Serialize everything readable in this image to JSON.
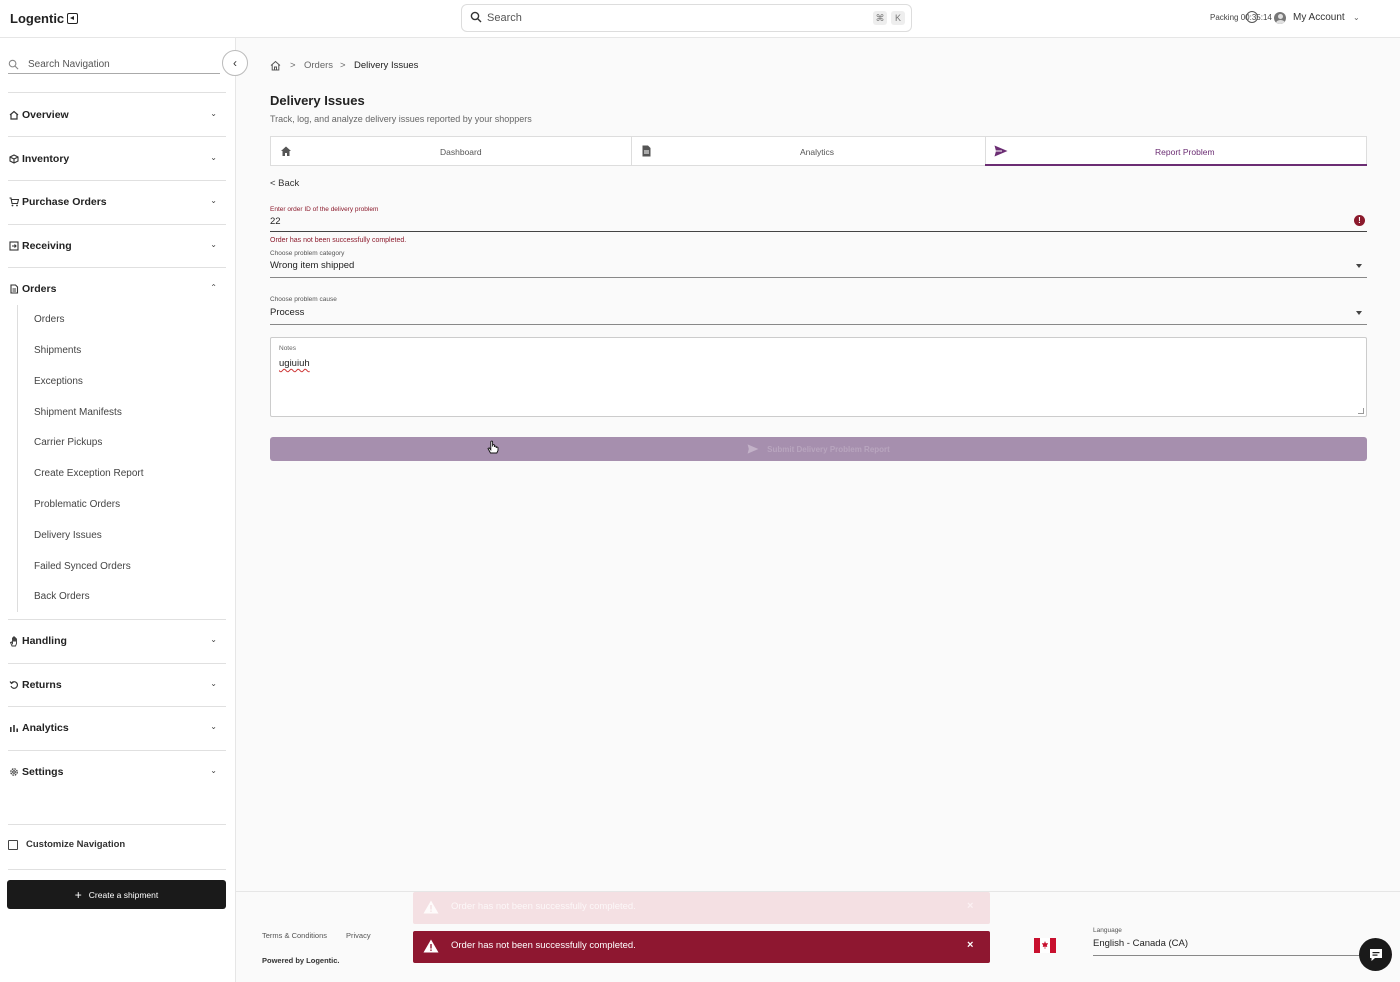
{
  "app": {
    "name": "Logentic"
  },
  "topbar": {
    "search_placeholder": "Search",
    "kbd_cmd": "⌘",
    "kbd_k": "K",
    "packing_label": "Packing",
    "packing_time": "00:35:14",
    "account_label": "My Account"
  },
  "sidebar": {
    "search_placeholder": "Search Navigation",
    "groups": [
      {
        "label": "Overview"
      },
      {
        "label": "Inventory"
      },
      {
        "label": "Purchase Orders"
      },
      {
        "label": "Receiving"
      },
      {
        "label": "Orders"
      },
      {
        "label": "Handling"
      },
      {
        "label": "Returns"
      },
      {
        "label": "Analytics"
      },
      {
        "label": "Settings"
      }
    ],
    "order_items": [
      "Orders",
      "Shipments",
      "Exceptions",
      "Shipment Manifests",
      "Carrier Pickups",
      "Create Exception Report",
      "Problematic Orders",
      "Delivery Issues",
      "Failed Synced Orders",
      "Back Orders"
    ],
    "customize_label": "Customize Navigation",
    "create_button": "Create a shipment"
  },
  "breadcrumb": {
    "sep": ">",
    "orders": "Orders",
    "current": "Delivery Issues"
  },
  "page": {
    "title": "Delivery Issues",
    "subtitle": "Track, log, and analyze delivery issues reported by your shoppers"
  },
  "tabs": [
    {
      "label": "Dashboard",
      "icon": "home-icon"
    },
    {
      "label": "Analytics",
      "icon": "document-icon"
    },
    {
      "label": "Report Problem",
      "icon": "send-icon",
      "active": true
    }
  ],
  "form": {
    "back_label": "< Back",
    "order_id_label": "Enter order ID of the delivery problem",
    "order_id_value": "22",
    "order_id_error": "Order has not been successfully completed.",
    "category_label": "Choose problem category",
    "category_value": "Wrong item shipped",
    "cause_label": "Choose problem cause",
    "cause_value": "Process",
    "notes_label": "Notes",
    "notes_value": "ugiuiuh",
    "submit_label": "Submit Delivery Problem Report"
  },
  "footer": {
    "terms": "Terms & Conditions",
    "privacy": "Privacy",
    "powered": "Powered by Logentic.",
    "language_label": "Language",
    "language_value": "English - Canada (CA)"
  },
  "toasts": [
    {
      "message": "Order has not been successfully completed.",
      "state": "fading"
    },
    {
      "message": "Order has not been successfully completed.",
      "state": "active"
    }
  ],
  "colors": {
    "accent": "#6b2d73",
    "error": "#8b1a2c",
    "toast": "#8e1730",
    "submit_disabled": "#a68fae"
  }
}
